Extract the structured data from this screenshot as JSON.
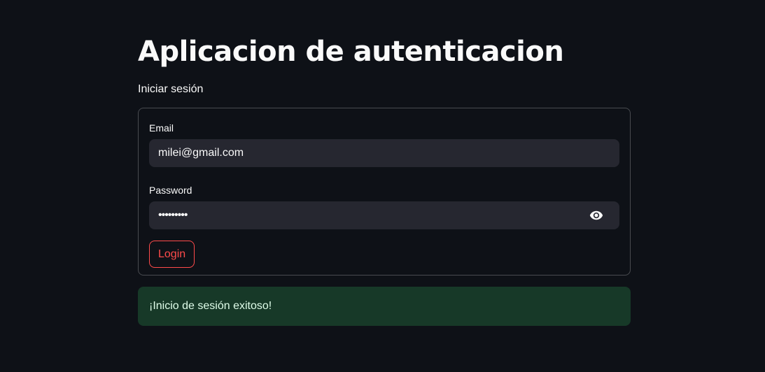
{
  "page": {
    "title": "Aplicacion de autenticacion",
    "subheader": "Iniciar sesión"
  },
  "form": {
    "email": {
      "label": "Email",
      "value": "milei@gmail.com"
    },
    "password": {
      "label": "Password",
      "masked_value": "•••••••••",
      "toggle_icon": "eye-icon"
    },
    "submit_label": "Login"
  },
  "alert": {
    "type": "success",
    "message": "¡Inicio de sesión exitoso!"
  },
  "colors": {
    "background": "#0e1117",
    "input_background": "#262730",
    "accent": "#ff4b4b",
    "success_background": "#173928",
    "success_text": "#dffde9"
  }
}
